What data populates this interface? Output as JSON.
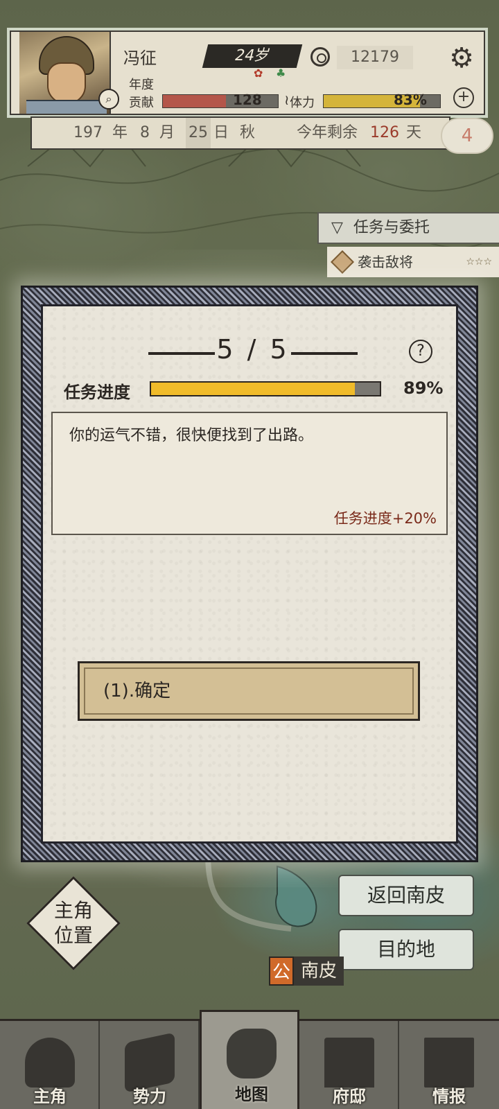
{
  "player": {
    "name": "冯征",
    "age": "24岁",
    "coins": "12179",
    "stat_year_label": "年度",
    "contribution_label": "贡献",
    "contribution_value": "128",
    "contribution_fill": 0.55,
    "stamina_label": "体力",
    "stamina_value": "83%",
    "stamina_fill": 0.83
  },
  "date_bar": {
    "year": "197",
    "year_unit": "年",
    "month": "8",
    "month_unit": "月",
    "day": "25",
    "day_unit": "日",
    "season": "秋",
    "remaining_label": "今年剩余",
    "remaining_days": "126",
    "remaining_unit": "天",
    "badge": "4"
  },
  "quests": {
    "header": "任务与委托",
    "item_label": "袭击敌将",
    "item_stars": "☆☆☆"
  },
  "dialog": {
    "page": "5 / 5",
    "progress_label": "任务进度",
    "progress_value": "89%",
    "progress_fill": 0.89,
    "message": "你的运气不错，很快便找到了出路。",
    "effect": "任务进度+20%",
    "option": "(1).确定"
  },
  "map_controls": {
    "position_button": "主角\n位置",
    "return_button": "返回南皮",
    "destination_button": "目的地",
    "city_flag": "公",
    "city_name": "南皮"
  },
  "nav": {
    "items": [
      {
        "label": "主角",
        "icon": "hero-icon"
      },
      {
        "label": "势力",
        "icon": "flag-icon"
      },
      {
        "label": "地图",
        "icon": "map-icon"
      },
      {
        "label": "府邸",
        "icon": "mansion-icon"
      },
      {
        "label": "情报",
        "icon": "scroll-icon"
      }
    ],
    "active_index": 2
  },
  "colors": {
    "progress_fill": "#f0bb2a",
    "contribution_fill": "#b4564a",
    "stamina_fill": "#d4b43a",
    "effect_text": "#7a2a1a"
  }
}
